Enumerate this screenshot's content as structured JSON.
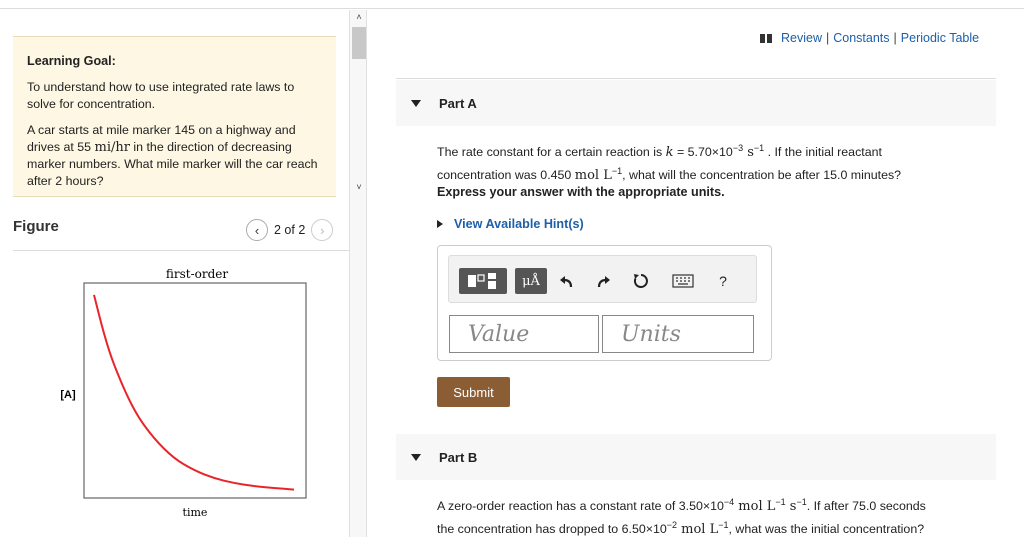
{
  "goal": {
    "title": "Learning Goal:",
    "p1": "To understand how to use integrated rate laws to solve for concentration.",
    "p2_pre": "A car starts at mile marker 145 on a highway and drives at 55 ",
    "p2_unit": "mi/hr",
    "p2_post": " in the direction of decreasing marker numbers. What mile marker will the car reach after 2 hours?"
  },
  "figure": {
    "title": "Figure",
    "pager": "2 of 2"
  },
  "chart_data": {
    "type": "line",
    "title": "first-order",
    "xlabel": "time",
    "ylabel": "[A]",
    "series": [
      {
        "points": [
          [
            0,
            1.0
          ],
          [
            0.05,
            0.8
          ],
          [
            0.1,
            0.64
          ],
          [
            0.2,
            0.41
          ],
          [
            0.3,
            0.27
          ],
          [
            0.4,
            0.17
          ],
          [
            0.5,
            0.11
          ],
          [
            0.6,
            0.07
          ],
          [
            0.7,
            0.045
          ],
          [
            0.8,
            0.03
          ],
          [
            0.9,
            0.02
          ],
          [
            1.0,
            0.012
          ]
        ]
      }
    ],
    "xlim": [
      0,
      1
    ],
    "ylim": [
      0,
      1.05
    ],
    "grid": false,
    "colors": {
      "line": "#e8262a",
      "frame": "#666666"
    }
  },
  "links": {
    "review": "Review",
    "constants": "Constants",
    "periodic": "Periodic Table",
    "sep": "|"
  },
  "partA": {
    "label": "Part A",
    "q1_pre": "The rate constant for a certain reaction is ",
    "q1_k": "k",
    "q1_eq": " = 5.70×10",
    "q1_exp": "−3",
    "q1_unit": " s",
    "q1_uexp": "−1",
    "q1_post": " . If the initial reactant",
    "q2_pre": "concentration was 0.450 ",
    "q2_unit": "mol L",
    "q2_uexp": "−1",
    "q2_post": ", what will the concentration be after 15.0 minutes?",
    "instruction": "Express your answer with the appropriate units.",
    "hint": "View Available Hint(s)",
    "toolbar": {
      "units_label": "μÅ",
      "help_label": "?"
    },
    "value_placeholder": "Value",
    "units_placeholder": "Units",
    "submit": "Submit"
  },
  "partB": {
    "label": "Part B",
    "q1_pre": "A zero-order reaction has a constant rate of 3.50×10",
    "q1_exp": "−4",
    "q1_unit": " mol L",
    "q1_uexp": "−1",
    "q1_unit2": " s",
    "q1_uexp2": "−1",
    "q1_post": ". If after 75.0 seconds",
    "q2_pre": "the concentration has dropped to 6.50×10",
    "q2_exp": "−2",
    "q2_unit": " mol L",
    "q2_uexp": "−1",
    "q2_post": ", what was the initial concentration?"
  }
}
